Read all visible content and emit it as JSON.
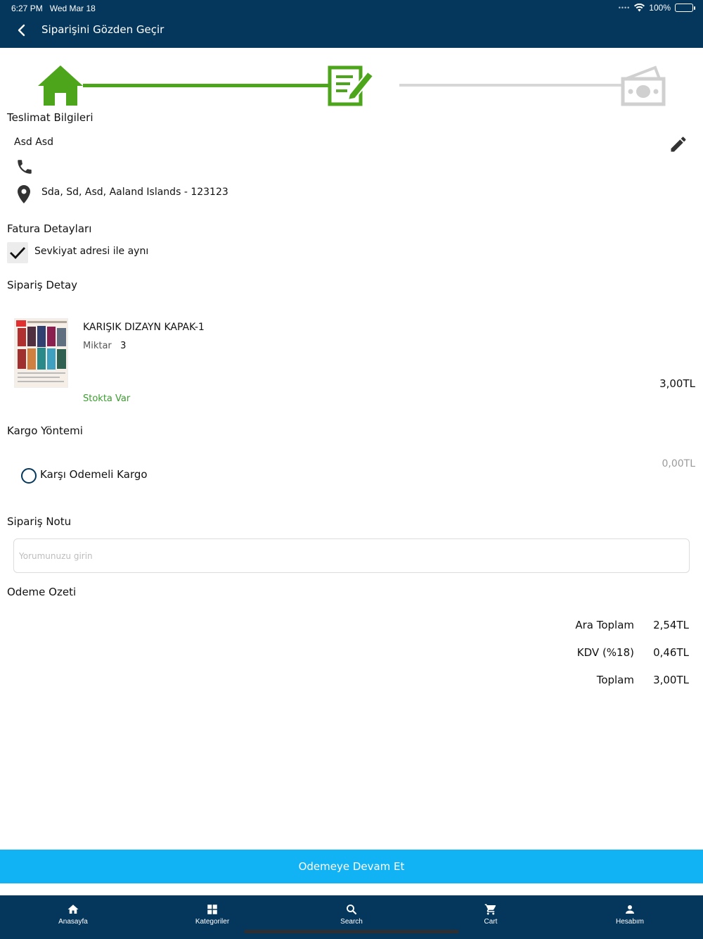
{
  "status_bar": {
    "time": "6:27 PM",
    "date": "Wed Mar 18",
    "battery": "100%"
  },
  "header": {
    "title": "Siparişini Gözden Geçir"
  },
  "stepper": {
    "steps": [
      "home-icon",
      "form-edit-icon",
      "money-icon"
    ],
    "active_step": 2
  },
  "delivery": {
    "section_title": "Teslimat Bilgileri",
    "name": "Asd Asd",
    "phone": "",
    "address": "Sda, Sd, Asd, Aaland Islands - 123123"
  },
  "billing": {
    "section_title": "Fatura Detayları",
    "same_as_shipping_label": "Sevkiyat adresi ile aynı",
    "same_as_shipping_checked": true
  },
  "order": {
    "section_title": "Sipariş Detay",
    "items": [
      {
        "name": "KARIŞIK DIZAYN KAPAK-1",
        "qty_label": "Miktar",
        "qty": "3",
        "price": "3,00TL",
        "stock": "Stokta Var"
      }
    ]
  },
  "shipping": {
    "section_title": "Kargo Yöntemi",
    "options": [
      {
        "label": "Karşı Odemeli Kargo",
        "price": "0,00TL",
        "selected": false
      }
    ]
  },
  "note": {
    "section_title": "Sipariş Notu",
    "placeholder": "Yorumunuzu girin",
    "value": ""
  },
  "summary": {
    "section_title": "Odeme Ozeti",
    "rows": [
      {
        "label": "Ara Toplam",
        "value": "2,54TL"
      },
      {
        "label": "KDV (%18)",
        "value": "0,46TL"
      },
      {
        "label": "Toplam",
        "value": "3,00TL"
      }
    ]
  },
  "cta": {
    "label": "Odemeye Devam Et"
  },
  "tabbar": {
    "items": [
      {
        "label": "Anasayfa",
        "icon": "home-icon"
      },
      {
        "label": "Kategoriler",
        "icon": "grid-icon"
      },
      {
        "label": "Search",
        "icon": "search-icon"
      },
      {
        "label": "Cart",
        "icon": "cart-icon"
      },
      {
        "label": "Hesabım",
        "icon": "person-icon"
      }
    ]
  },
  "colors": {
    "header": "#05375c",
    "accent_green": "#4ca51b",
    "cta": "#12b3f5",
    "stock_green": "#3b9e2f"
  }
}
